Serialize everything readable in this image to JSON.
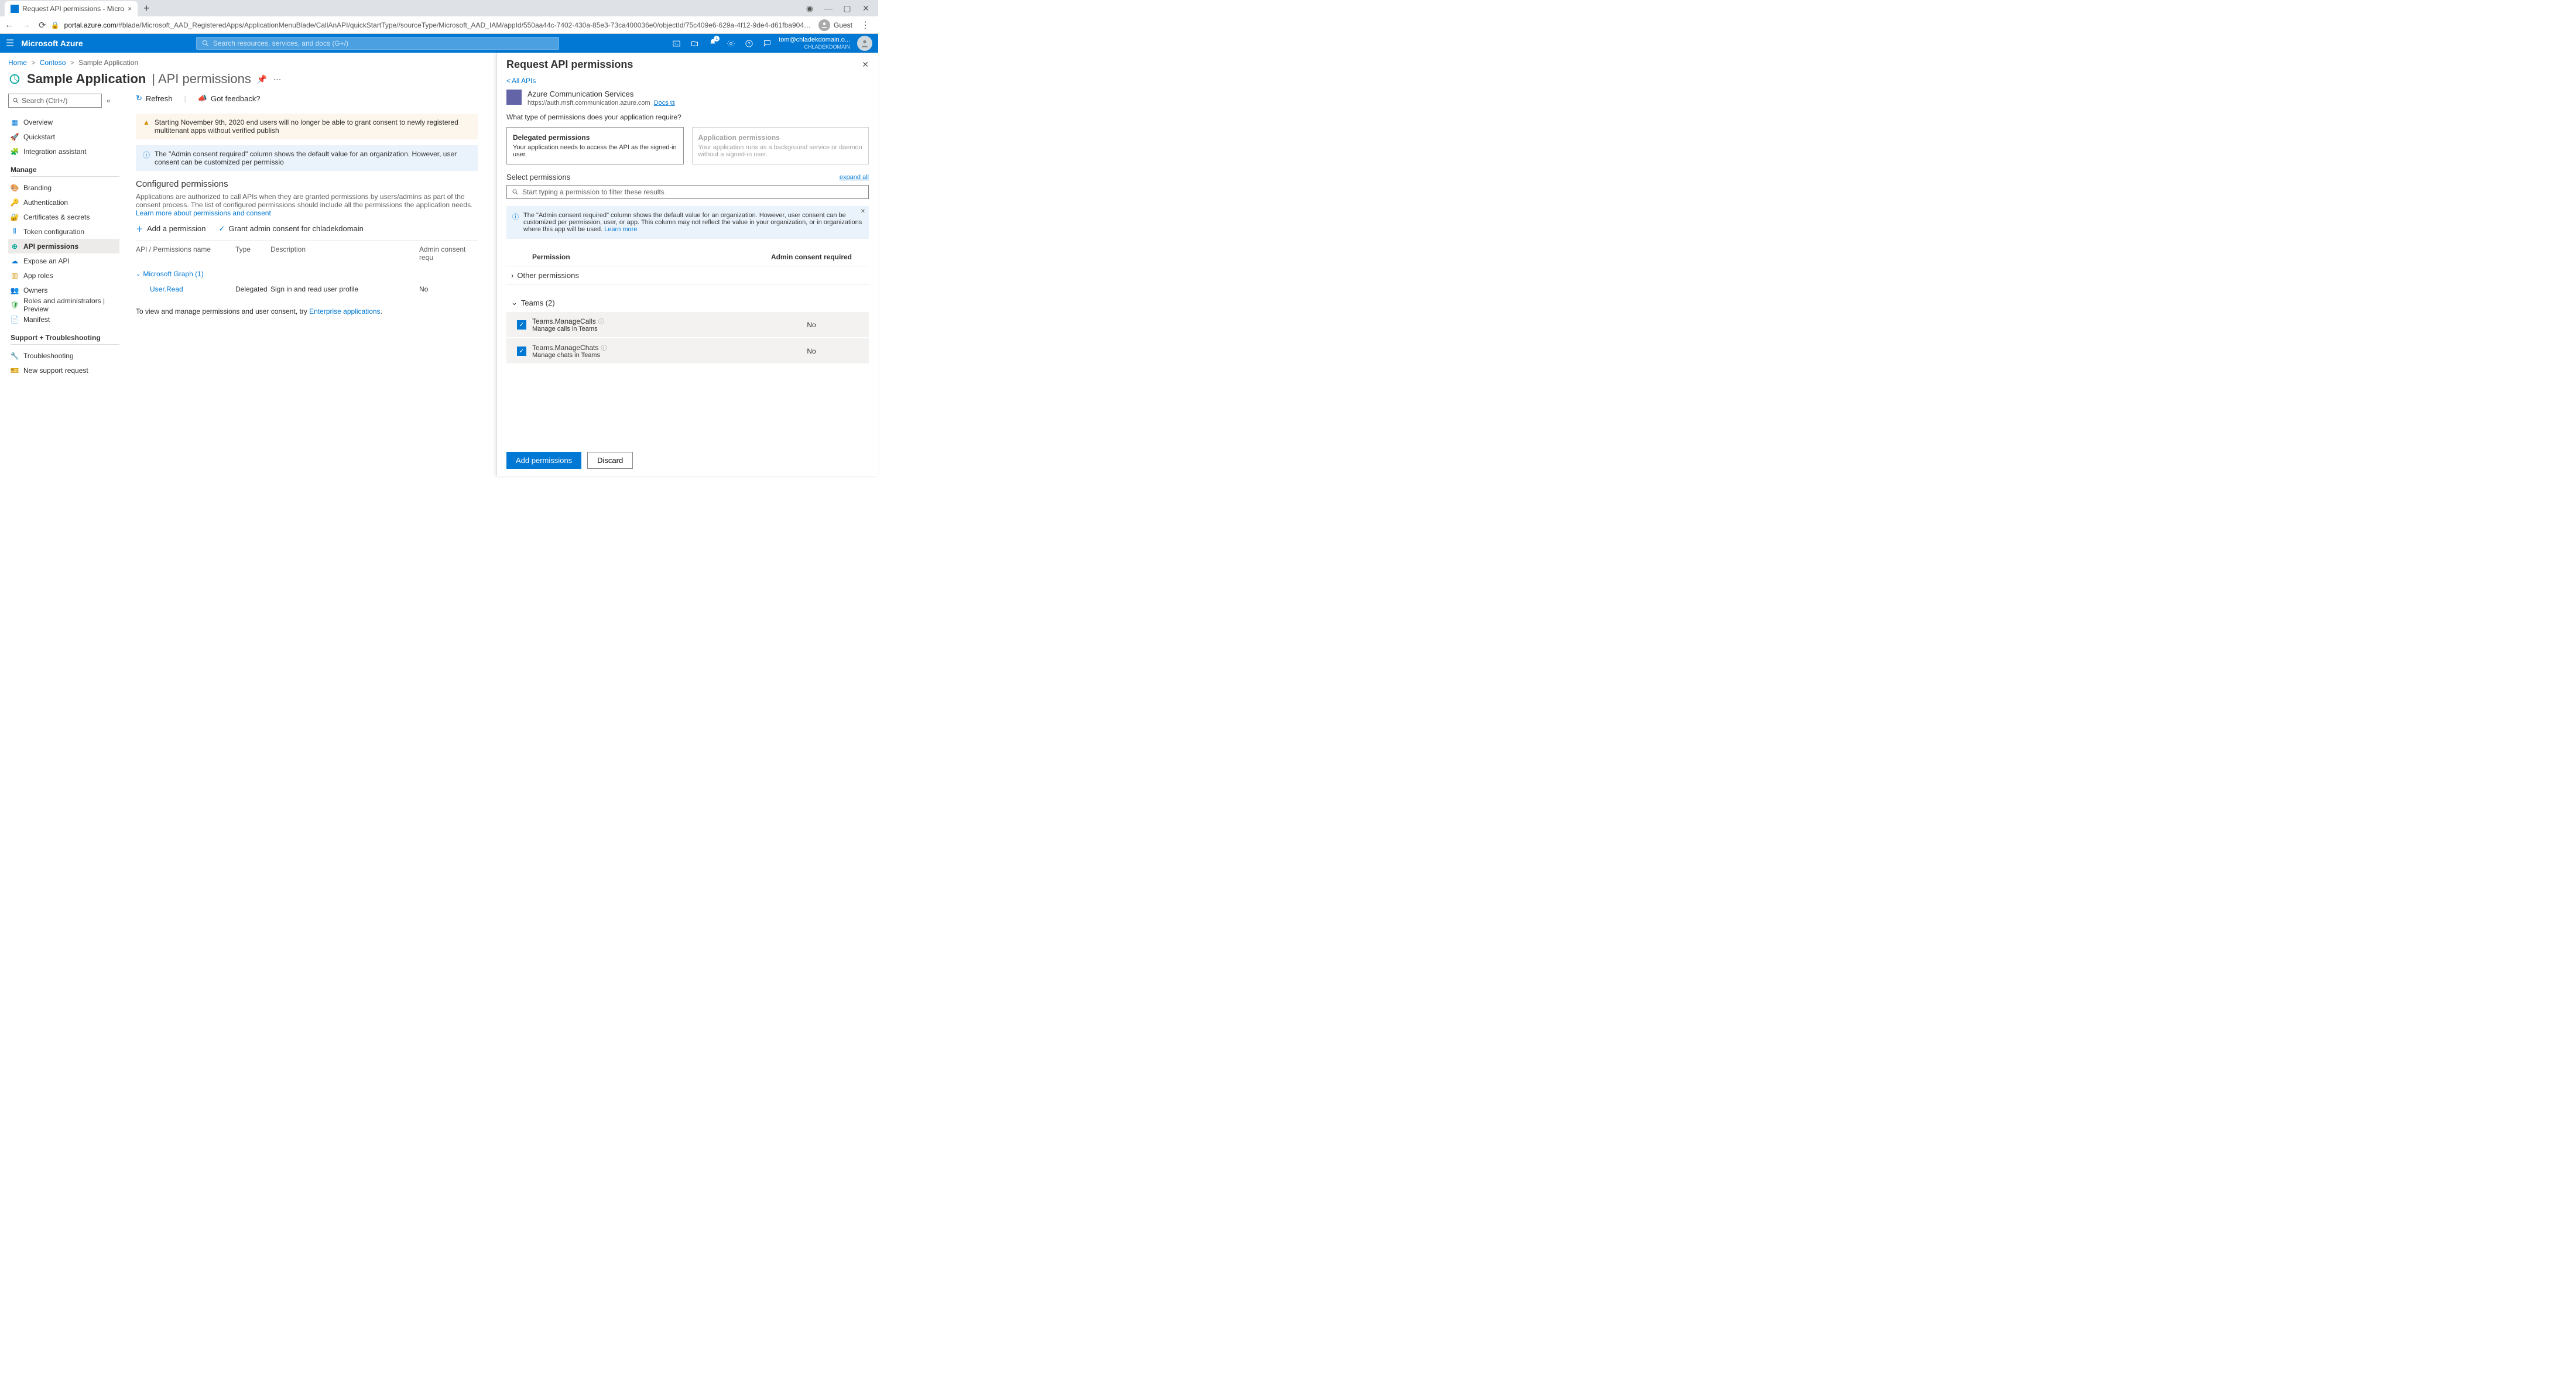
{
  "browser": {
    "tab_title": "Request API permissions - Micro",
    "url_prefix": "portal.azure.com",
    "url_rest": "/#blade/Microsoft_AAD_RegisteredApps/ApplicationMenuBlade/CallAnAPI/quickStartType//sourceType/Microsoft_AAD_IAM/appId/550aa44c-7402-430a-85e3-73ca400036e0/objectId/75c409e6-629a-4f12-9de4-d61fba904807/isMSAApp//defaultBl...",
    "guest": "Guest"
  },
  "header": {
    "brand": "Microsoft Azure",
    "search_placeholder": "Search resources, services, and docs (G+/)",
    "account_email": "tom@chladekdomain.o...",
    "tenant": "CHLADEKDOMAIN"
  },
  "breadcrumb": {
    "home": "Home",
    "contoso": "Contoso",
    "sample": "Sample Application"
  },
  "page": {
    "title": "Sample Application",
    "subtitle": "API permissions",
    "search_ph": "Search (Ctrl+/)",
    "nav": {
      "overview": "Overview",
      "quickstart": "Quickstart",
      "integration": "Integration assistant",
      "manage": "Manage",
      "branding": "Branding",
      "authentication": "Authentication",
      "certificates": "Certificates & secrets",
      "token": "Token configuration",
      "api_perm": "API permissions",
      "expose": "Expose an API",
      "app_roles": "App roles",
      "owners": "Owners",
      "roles_admin": "Roles and administrators | Preview",
      "manifest": "Manifest",
      "support": "Support + Troubleshooting",
      "troubleshooting": "Troubleshooting",
      "new_support": "New support request"
    },
    "cmdbar": {
      "refresh": "Refresh",
      "feedback": "Got feedback?"
    },
    "alert_warn": "Starting November 9th, 2020 end users will no longer be able to grant consent to newly registered multitenant apps without verified publish",
    "alert_info": "The \"Admin consent required\" column shows the default value for an organization. However, user consent can be customized per permissio",
    "config_title": "Configured permissions",
    "config_desc": "Applications are authorized to call APIs when they are granted permissions by users/admins as part of the consent process. The list of configured permissions should include all the permissions the application needs. ",
    "learn_link": "Learn more about permissions and consent",
    "add_perm": "Add a permission",
    "grant_admin": "Grant admin consent for chladekdomain",
    "cols": {
      "api": "API / Permissions name",
      "type": "Type",
      "desc": "Description",
      "admin": "Admin consent requ"
    },
    "group_ms": "Microsoft Graph (1)",
    "row": {
      "name": "User.Read",
      "type": "Delegated",
      "desc": "Sign in and read user profile",
      "admin": "No"
    },
    "view_manage_pre": "To view and manage permissions and user consent, try ",
    "view_manage_link": "Enterprise applications"
  },
  "panel": {
    "title": "Request API permissions",
    "all_apis": "All APIs",
    "api_name": "Azure Communication Services",
    "api_url": "https://auth.msft.communication.azure.com",
    "docs": "Docs",
    "question": "What type of permissions does your application require?",
    "delegated": {
      "title": "Delegated permissions",
      "desc": "Your application needs to access the API as the signed-in user."
    },
    "application": {
      "title": "Application permissions",
      "desc": "Your application runs as a background service or daemon without a signed-in user."
    },
    "select_perm": "Select permissions",
    "expand_all": "expand all",
    "search_ph": "Start typing a permission to filter these results",
    "info_text": "The \"Admin consent required\" column shows the default value for an organization. However, user consent can be customized per permission, user, or app. This column may not reflect the value in your organization, or in organizations where this app will be used. ",
    "info_link": "Learn more",
    "col_perm": "Permission",
    "col_admin": "Admin consent required",
    "group_other": "Other permissions",
    "group_teams": "Teams (2)",
    "perms": [
      {
        "name": "Teams.ManageCalls",
        "desc": "Manage calls in Teams",
        "admin": "No"
      },
      {
        "name": "Teams.ManageChats",
        "desc": "Manage chats in Teams",
        "admin": "No"
      }
    ],
    "btn_add": "Add permissions",
    "btn_discard": "Discard"
  }
}
